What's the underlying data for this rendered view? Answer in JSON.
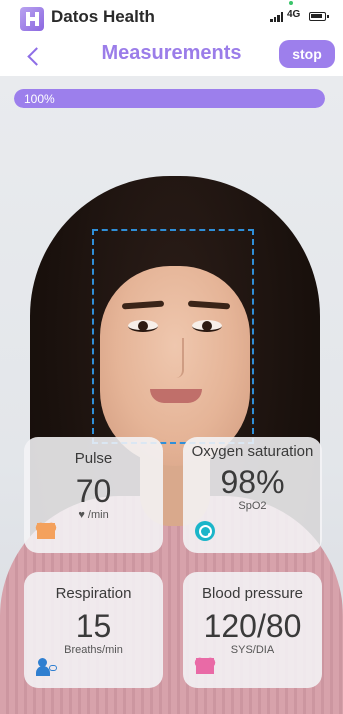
{
  "status_bar": {
    "app_name": "Datos Health",
    "network": "4G"
  },
  "nav": {
    "title": "Measurements",
    "stop_label": "stop"
  },
  "progress": {
    "label": "100%",
    "fraction": 1.0
  },
  "cards": {
    "pulse": {
      "title": "Pulse",
      "value": "70",
      "unit": "♥ /min",
      "icon": "heart-icon",
      "icon_color": "#f4a15c"
    },
    "oxygen": {
      "title": "Oxygen saturation",
      "value": "98%",
      "unit": "SpO2",
      "icon": "oxygen-icon",
      "icon_color": "#1bb5c9"
    },
    "respiration": {
      "title": "Respiration",
      "value": "15",
      "unit": "Breaths/min",
      "icon": "lungs-icon",
      "icon_color": "#2f7fd0"
    },
    "blood_pressure": {
      "title": "Blood pressure",
      "value": "120/80",
      "unit": "SYS/DIA",
      "icon": "heart-icon",
      "icon_color": "#e96aa6"
    }
  },
  "colors": {
    "accent": "#9b7de9",
    "frame": "#2f8fd8"
  }
}
